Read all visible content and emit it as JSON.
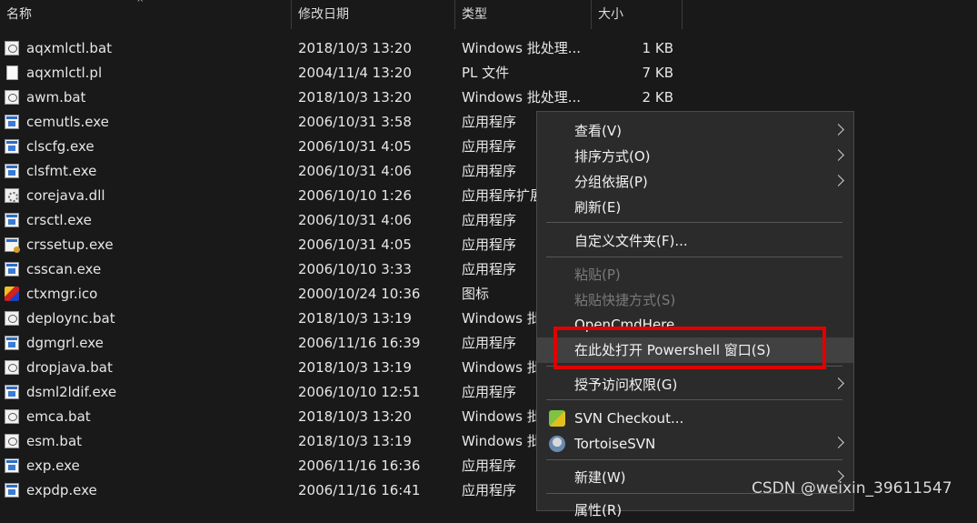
{
  "columns": {
    "name": "名称",
    "date": "修改日期",
    "type": "类型",
    "size": "大小"
  },
  "files": [
    {
      "name": "aqxmlctl.bat",
      "date": "2018/10/3 13:20",
      "type": "Windows 批处理...",
      "size": "1 KB",
      "icon": "bat-file-icon"
    },
    {
      "name": "aqxmlctl.pl",
      "date": "2004/11/4 13:20",
      "type": "PL 文件",
      "size": "7 KB",
      "icon": "doc-file-icon"
    },
    {
      "name": "awm.bat",
      "date": "2018/10/3 13:20",
      "type": "Windows 批处理...",
      "size": "2 KB",
      "icon": "bat-file-icon"
    },
    {
      "name": "cemutls.exe",
      "date": "2006/10/31 3:58",
      "type": "应用程序",
      "size": "",
      "icon": "exe-file-icon"
    },
    {
      "name": "clscfg.exe",
      "date": "2006/10/31 4:05",
      "type": "应用程序",
      "size": "",
      "icon": "exe-file-icon"
    },
    {
      "name": "clsfmt.exe",
      "date": "2006/10/31 4:06",
      "type": "应用程序",
      "size": "",
      "icon": "exe-file-icon"
    },
    {
      "name": "corejava.dll",
      "date": "2006/10/10 1:26",
      "type": "应用程序扩展",
      "size": "",
      "icon": "dll-file-icon"
    },
    {
      "name": "crsctl.exe",
      "date": "2006/10/31 4:06",
      "type": "应用程序",
      "size": "",
      "icon": "exe-file-icon"
    },
    {
      "name": "crssetup.exe",
      "date": "2006/10/31 4:05",
      "type": "应用程序",
      "size": "",
      "icon": "setup-exe-icon"
    },
    {
      "name": "csscan.exe",
      "date": "2006/10/10 3:33",
      "type": "应用程序",
      "size": "",
      "icon": "exe-file-icon"
    },
    {
      "name": "ctxmgr.ico",
      "date": "2000/10/24 10:36",
      "type": "图标",
      "size": "",
      "icon": "ico-file-icon"
    },
    {
      "name": "deploync.bat",
      "date": "2018/10/3 13:19",
      "type": "Windows 批",
      "size": "",
      "icon": "bat-file-icon"
    },
    {
      "name": "dgmgrl.exe",
      "date": "2006/11/16 16:39",
      "type": "应用程序",
      "size": "",
      "icon": "exe-file-icon"
    },
    {
      "name": "dropjava.bat",
      "date": "2018/10/3 13:19",
      "type": "Windows 批",
      "size": "",
      "icon": "bat-file-icon"
    },
    {
      "name": "dsml2ldif.exe",
      "date": "2006/10/10 12:51",
      "type": "应用程序",
      "size": "",
      "icon": "exe-file-icon"
    },
    {
      "name": "emca.bat",
      "date": "2018/10/3 13:20",
      "type": "Windows 批",
      "size": "",
      "icon": "bat-file-icon"
    },
    {
      "name": "esm.bat",
      "date": "2018/10/3 13:19",
      "type": "Windows 批",
      "size": "",
      "icon": "bat-file-icon"
    },
    {
      "name": "exp.exe",
      "date": "2006/11/16 16:36",
      "type": "应用程序",
      "size": "",
      "icon": "exe-file-icon"
    },
    {
      "name": "expdp.exe",
      "date": "2006/11/16 16:41",
      "type": "应用程序",
      "size": "",
      "icon": "exe-file-icon"
    }
  ],
  "context_menu": {
    "view": "查看(V)",
    "sort": "排序方式(O)",
    "group": "分组依据(P)",
    "refresh": "刷新(E)",
    "customize": "自定义文件夹(F)...",
    "paste": "粘贴(P)",
    "paste_shortcut": "粘贴快捷方式(S)",
    "open_cmd": "OpenCmdHere",
    "powershell": "在此处打开 Powershell 窗口(S)",
    "grant_access": "授予访问权限(G)",
    "svn_checkout": "SVN Checkout...",
    "tortoise_svn": "TortoiseSVN",
    "new": "新建(W)",
    "properties": "属性(R)"
  },
  "highlight_color": "#e00000",
  "watermark": "CSDN @weixin_39611547"
}
